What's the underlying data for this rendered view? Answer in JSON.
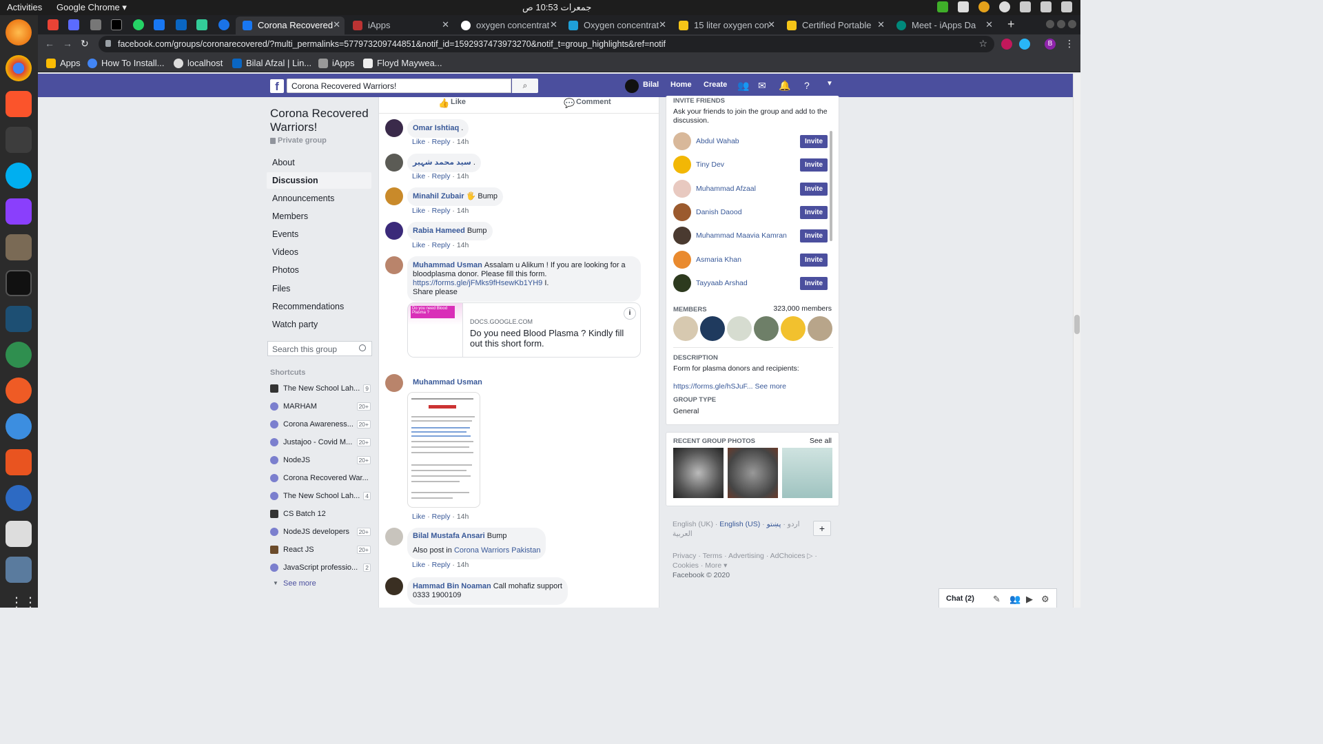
{
  "os": {
    "activities": "Activities",
    "app_name": "Google Chrome ▾",
    "clock": "جمعرات 10:53 ص"
  },
  "chrome": {
    "tabs": [
      {
        "title": "Corona Recovered",
        "active": true
      },
      {
        "title": "iApps"
      },
      {
        "title": "oxygen concentrat"
      },
      {
        "title": "Oxygen concentrat"
      },
      {
        "title": "15 liter oxygen con"
      },
      {
        "title": "Certified Portable"
      },
      {
        "title": "Meet - iApps Da"
      }
    ],
    "url": "facebook.com/groups/coronarecovered/?multi_permalinks=577973209744851&notif_id=1592937473973270&notif_t=group_highlights&ref=notif",
    "bookmarks": [
      "Apps",
      "How To Install...",
      "localhost",
      "Bilal Afzal | Lin...",
      "iApps",
      "Floyd Maywea..."
    ],
    "profile_initial": "B"
  },
  "fb_header": {
    "search_value": "Corona Recovered Warriors!",
    "user_name": "Bilal",
    "home": "Home",
    "create": "Create"
  },
  "group": {
    "title": "Corona Recovered Warriors!",
    "privacy": "Private group",
    "nav": [
      "About",
      "Discussion",
      "Announcements",
      "Members",
      "Events",
      "Videos",
      "Photos",
      "Files",
      "Recommendations",
      "Watch party"
    ],
    "search_placeholder": "Search this group",
    "shortcuts_label": "Shortcuts",
    "shortcuts": [
      {
        "name": "The New School Lah...",
        "count": "9"
      },
      {
        "name": "MARHAM",
        "count": "20+"
      },
      {
        "name": "Corona Awareness...",
        "count": "20+"
      },
      {
        "name": "Justajoo - Covid M...",
        "count": "20+"
      },
      {
        "name": "NodeJS",
        "count": "20+"
      },
      {
        "name": "Corona Recovered War...",
        "count": ""
      },
      {
        "name": "The New School Lah...",
        "count": "4"
      },
      {
        "name": "CS Batch 12",
        "count": ""
      },
      {
        "name": "NodeJS developers",
        "count": "20+"
      },
      {
        "name": "React JS",
        "count": "20+"
      },
      {
        "name": "JavaScript professio...",
        "count": "2"
      }
    ],
    "see_more": "See more"
  },
  "post_actions": {
    "like": "Like",
    "comment": "Comment"
  },
  "comment_meta": {
    "like": "Like",
    "reply": "Reply",
    "time": "14h",
    "sep": "·"
  },
  "comments": [
    {
      "author": "Omar Ishtiaq",
      "text": "."
    },
    {
      "author": "سید محمد شہیر",
      "text": "."
    },
    {
      "author": "Minahil Zubair",
      "text": "🖐 Bump"
    },
    {
      "author": "Rabia Hameed",
      "text": "Bump"
    },
    {
      "author": "Muhammad Usman",
      "text": "Assalam u Alikum ! If you are looking for a bloodplasma donor. Please fill this form.",
      "link": "https://forms.gle/jFMks9fHsewKb1YH9",
      "after_link": " I.",
      "text2": "Share please"
    },
    {
      "author": "Muhammad Usman",
      "text": ""
    },
    {
      "author": "Bilal Mustafa Ansari",
      "text": "Bump",
      "line2_prefix": "Also post in",
      "line2_link": "Corona Warriors Pakistan"
    },
    {
      "author": "Hammad Bin Noaman",
      "text": "Call mohafiz support",
      "text2": "0333 1900109"
    }
  ],
  "link_card": {
    "domain": "DOCS.GOOGLE.COM",
    "title": "Do you need Blood Plasma ? Kindly fill out this short form.",
    "thumb_text": "Do you need Blood Plasma ?"
  },
  "right": {
    "invite_label": "INVITE FRIENDS",
    "invite_desc": "Ask your friends to join the group and add to the discussion.",
    "invite_button": "Invite",
    "friends": [
      "Abdul Wahab",
      "Tiny Dev",
      "Muhammad Afzaal",
      "Danish Daood",
      "Muhammad Maavia Kamran",
      "Asmaria Khan",
      "Tayyaab Arshad"
    ],
    "members_label": "MEMBERS",
    "members_count": "323,000 members",
    "description_label": "DESCRIPTION",
    "description": "Form for plasma donors and recipients:",
    "description_link": "https://forms.gle/hSJuF...",
    "see_more": "See more",
    "group_type_label": "GROUP TYPE",
    "group_type": "General",
    "photos_label": "RECENT GROUP PHOTOS",
    "see_all": "See all"
  },
  "languages": {
    "english_uk": "English (UK)",
    "english_us": "English (US)",
    "urdu": "اردو",
    "pashto": "پښتو",
    "arabic": "العربية",
    "plus": "+"
  },
  "footer": {
    "privacy": "Privacy",
    "terms": "Terms",
    "advertising": "Advertising",
    "adchoices": "AdChoices",
    "cookies": "Cookies",
    "more": "More",
    "copyright": "Facebook © 2020"
  },
  "chat": {
    "label": "Chat (2)"
  },
  "colors": {
    "fb_header": "#4b4f9e",
    "link": "#385898",
    "invite_button": "#4b4f9e"
  }
}
